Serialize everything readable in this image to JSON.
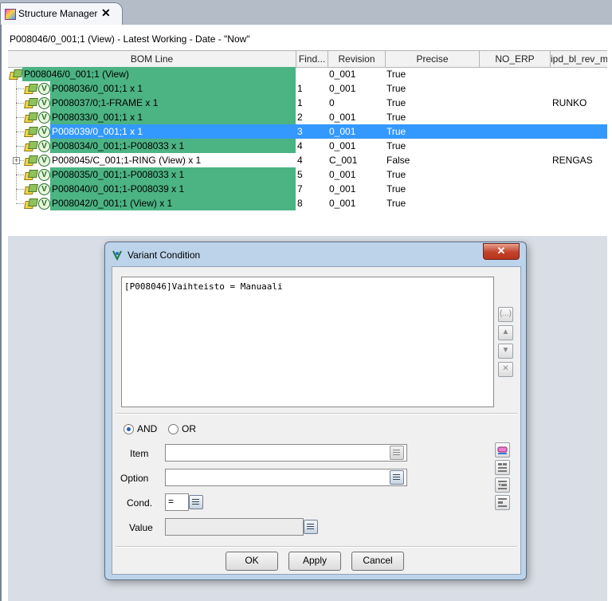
{
  "tab": {
    "title": "Structure Manager",
    "close_glyph": "✕"
  },
  "header": {
    "title": "P008046/0_001;1 (View) - Latest Working - Date - \"Now\""
  },
  "columns": [
    "BOM Line",
    "Find...",
    "Revision",
    "Precise",
    "NO_ERP",
    "ipd_bl_rev_m"
  ],
  "rows": [
    {
      "bom": "P008046/0_001;1 (View)",
      "find": "",
      "revision": "0_001",
      "precise": "True",
      "no_erp": "",
      "ipd": ""
    },
    {
      "bom": "P008036/0_001;1 x 1",
      "find": "1",
      "revision": "0_001",
      "precise": "True",
      "no_erp": "",
      "ipd": ""
    },
    {
      "bom": "P008037/0;1-FRAME x 1",
      "find": "1",
      "revision": "0",
      "precise": "True",
      "no_erp": "",
      "ipd": "RUNKO"
    },
    {
      "bom": "P008033/0_001;1 x 1",
      "find": "2",
      "revision": "0_001",
      "precise": "True",
      "no_erp": "",
      "ipd": ""
    },
    {
      "bom": "P008039/0_001;1 x 1",
      "find": "3",
      "revision": "0_001",
      "precise": "True",
      "no_erp": "",
      "ipd": ""
    },
    {
      "bom": "P008034/0_001;1-P008033 x 1",
      "find": "4",
      "revision": "0_001",
      "precise": "True",
      "no_erp": "",
      "ipd": ""
    },
    {
      "bom": "P008045/C_001;1-RING (View) x 1",
      "find": "4",
      "revision": "C_001",
      "precise": "False",
      "no_erp": "",
      "ipd": "RENGAS"
    },
    {
      "bom": "P008035/0_001;1-P008033 x 1",
      "find": "5",
      "revision": "0_001",
      "precise": "True",
      "no_erp": "",
      "ipd": ""
    },
    {
      "bom": "P008040/0_001;1-P008039 x 1",
      "find": "7",
      "revision": "0_001",
      "precise": "True",
      "no_erp": "",
      "ipd": ""
    },
    {
      "bom": "P008042/0_001;1 (View) x 1",
      "find": "8",
      "revision": "0_001",
      "precise": "True",
      "no_erp": "",
      "ipd": ""
    }
  ],
  "selected_row": 4,
  "dialog": {
    "title": "Variant Condition",
    "close_glyph": "✕",
    "condition_text": "[P008046]Vaihteisto = Manuaali",
    "side_buttons": [
      "(...)",
      "▲",
      "▼",
      "✕"
    ],
    "and_label": "AND",
    "or_label": "OR",
    "item_label": "Item",
    "option_label": "Option",
    "cond_label": "Cond.",
    "cond_value": "=",
    "value_label": "Value",
    "item_value": "",
    "option_value": "",
    "value_value": "",
    "ok_label": "OK",
    "apply_label": "Apply",
    "cancel_label": "Cancel"
  },
  "colors": {
    "green_fill": "#4cb383",
    "selection": "#3399ff",
    "dialog_frame": "#bcd3ea",
    "close_red": "#c2422a"
  }
}
